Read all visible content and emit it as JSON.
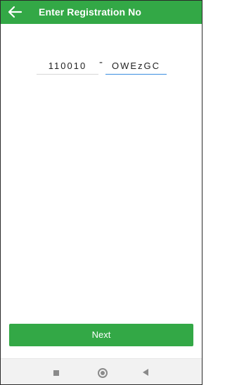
{
  "header": {
    "title": "Enter Registration No",
    "back_icon": "arrow-left-icon",
    "color": "#33a846"
  },
  "registration": {
    "part1": "110010",
    "separator": "-",
    "part2": "OWEzGC"
  },
  "actions": {
    "next_label": "Next",
    "color": "#33a846"
  },
  "navbar": {
    "icons": [
      "square-icon",
      "home-circle-icon",
      "back-triangle-icon"
    ]
  }
}
